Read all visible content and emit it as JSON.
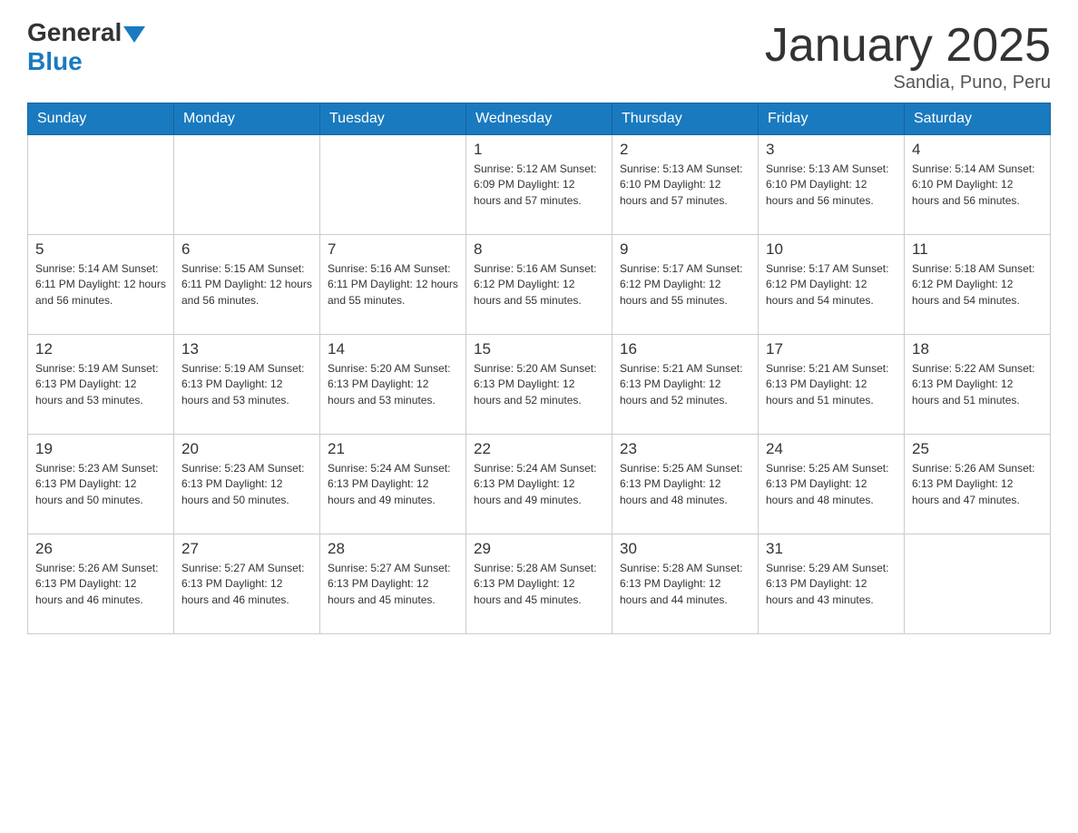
{
  "logo": {
    "general": "General",
    "blue": "Blue"
  },
  "title": "January 2025",
  "subtitle": "Sandia, Puno, Peru",
  "headers": [
    "Sunday",
    "Monday",
    "Tuesday",
    "Wednesday",
    "Thursday",
    "Friday",
    "Saturday"
  ],
  "weeks": [
    [
      {
        "day": "",
        "info": ""
      },
      {
        "day": "",
        "info": ""
      },
      {
        "day": "",
        "info": ""
      },
      {
        "day": "1",
        "info": "Sunrise: 5:12 AM\nSunset: 6:09 PM\nDaylight: 12 hours\nand 57 minutes."
      },
      {
        "day": "2",
        "info": "Sunrise: 5:13 AM\nSunset: 6:10 PM\nDaylight: 12 hours\nand 57 minutes."
      },
      {
        "day": "3",
        "info": "Sunrise: 5:13 AM\nSunset: 6:10 PM\nDaylight: 12 hours\nand 56 minutes."
      },
      {
        "day": "4",
        "info": "Sunrise: 5:14 AM\nSunset: 6:10 PM\nDaylight: 12 hours\nand 56 minutes."
      }
    ],
    [
      {
        "day": "5",
        "info": "Sunrise: 5:14 AM\nSunset: 6:11 PM\nDaylight: 12 hours\nand 56 minutes."
      },
      {
        "day": "6",
        "info": "Sunrise: 5:15 AM\nSunset: 6:11 PM\nDaylight: 12 hours\nand 56 minutes."
      },
      {
        "day": "7",
        "info": "Sunrise: 5:16 AM\nSunset: 6:11 PM\nDaylight: 12 hours\nand 55 minutes."
      },
      {
        "day": "8",
        "info": "Sunrise: 5:16 AM\nSunset: 6:12 PM\nDaylight: 12 hours\nand 55 minutes."
      },
      {
        "day": "9",
        "info": "Sunrise: 5:17 AM\nSunset: 6:12 PM\nDaylight: 12 hours\nand 55 minutes."
      },
      {
        "day": "10",
        "info": "Sunrise: 5:17 AM\nSunset: 6:12 PM\nDaylight: 12 hours\nand 54 minutes."
      },
      {
        "day": "11",
        "info": "Sunrise: 5:18 AM\nSunset: 6:12 PM\nDaylight: 12 hours\nand 54 minutes."
      }
    ],
    [
      {
        "day": "12",
        "info": "Sunrise: 5:19 AM\nSunset: 6:13 PM\nDaylight: 12 hours\nand 53 minutes."
      },
      {
        "day": "13",
        "info": "Sunrise: 5:19 AM\nSunset: 6:13 PM\nDaylight: 12 hours\nand 53 minutes."
      },
      {
        "day": "14",
        "info": "Sunrise: 5:20 AM\nSunset: 6:13 PM\nDaylight: 12 hours\nand 53 minutes."
      },
      {
        "day": "15",
        "info": "Sunrise: 5:20 AM\nSunset: 6:13 PM\nDaylight: 12 hours\nand 52 minutes."
      },
      {
        "day": "16",
        "info": "Sunrise: 5:21 AM\nSunset: 6:13 PM\nDaylight: 12 hours\nand 52 minutes."
      },
      {
        "day": "17",
        "info": "Sunrise: 5:21 AM\nSunset: 6:13 PM\nDaylight: 12 hours\nand 51 minutes."
      },
      {
        "day": "18",
        "info": "Sunrise: 5:22 AM\nSunset: 6:13 PM\nDaylight: 12 hours\nand 51 minutes."
      }
    ],
    [
      {
        "day": "19",
        "info": "Sunrise: 5:23 AM\nSunset: 6:13 PM\nDaylight: 12 hours\nand 50 minutes."
      },
      {
        "day": "20",
        "info": "Sunrise: 5:23 AM\nSunset: 6:13 PM\nDaylight: 12 hours\nand 50 minutes."
      },
      {
        "day": "21",
        "info": "Sunrise: 5:24 AM\nSunset: 6:13 PM\nDaylight: 12 hours\nand 49 minutes."
      },
      {
        "day": "22",
        "info": "Sunrise: 5:24 AM\nSunset: 6:13 PM\nDaylight: 12 hours\nand 49 minutes."
      },
      {
        "day": "23",
        "info": "Sunrise: 5:25 AM\nSunset: 6:13 PM\nDaylight: 12 hours\nand 48 minutes."
      },
      {
        "day": "24",
        "info": "Sunrise: 5:25 AM\nSunset: 6:13 PM\nDaylight: 12 hours\nand 48 minutes."
      },
      {
        "day": "25",
        "info": "Sunrise: 5:26 AM\nSunset: 6:13 PM\nDaylight: 12 hours\nand 47 minutes."
      }
    ],
    [
      {
        "day": "26",
        "info": "Sunrise: 5:26 AM\nSunset: 6:13 PM\nDaylight: 12 hours\nand 46 minutes."
      },
      {
        "day": "27",
        "info": "Sunrise: 5:27 AM\nSunset: 6:13 PM\nDaylight: 12 hours\nand 46 minutes."
      },
      {
        "day": "28",
        "info": "Sunrise: 5:27 AM\nSunset: 6:13 PM\nDaylight: 12 hours\nand 45 minutes."
      },
      {
        "day": "29",
        "info": "Sunrise: 5:28 AM\nSunset: 6:13 PM\nDaylight: 12 hours\nand 45 minutes."
      },
      {
        "day": "30",
        "info": "Sunrise: 5:28 AM\nSunset: 6:13 PM\nDaylight: 12 hours\nand 44 minutes."
      },
      {
        "day": "31",
        "info": "Sunrise: 5:29 AM\nSunset: 6:13 PM\nDaylight: 12 hours\nand 43 minutes."
      },
      {
        "day": "",
        "info": ""
      }
    ]
  ]
}
